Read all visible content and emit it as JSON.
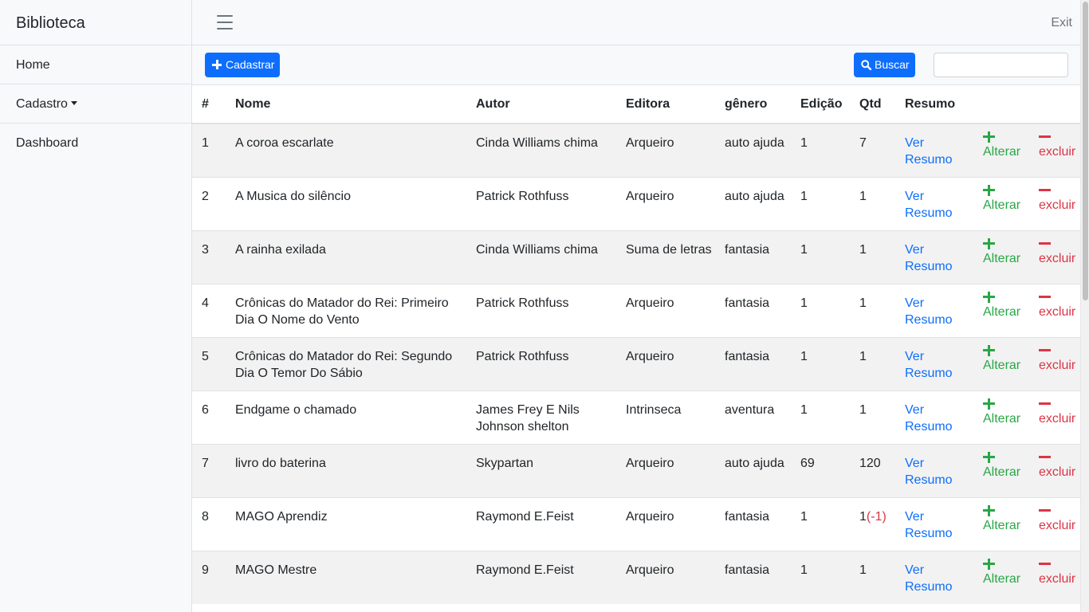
{
  "sidebar": {
    "brand": "Biblioteca",
    "items": [
      {
        "label": "Home"
      },
      {
        "label": "Cadastro"
      },
      {
        "label": "Dashboard"
      }
    ]
  },
  "topbar": {
    "exit_label": "Exit"
  },
  "toolbar": {
    "cadastrar_label": "Cadastrar",
    "buscar_label": "Buscar",
    "search_value": "",
    "search_placeholder": ""
  },
  "table": {
    "headers": [
      "#",
      "Nome",
      "Autor",
      "Editora",
      "gênero",
      "Edição",
      "Qtd",
      "Resumo"
    ],
    "ver_resumo_label": "Ver Resumo",
    "alterar_label": "Alterar",
    "excluir_label": "excluir",
    "rows": [
      {
        "id": "1",
        "nome": "A coroa escarlate",
        "autor": "Cinda Williams chima",
        "editora": "Arqueiro",
        "genero": "auto ajuda",
        "edicao": "1",
        "qtd": "7",
        "qtd_delta": ""
      },
      {
        "id": "2",
        "nome": "A Musica do silêncio",
        "autor": "Patrick Rothfuss",
        "editora": "Arqueiro",
        "genero": "auto ajuda",
        "edicao": "1",
        "qtd": "1",
        "qtd_delta": ""
      },
      {
        "id": "3",
        "nome": "A rainha exilada",
        "autor": "Cinda Williams chima",
        "editora": "Suma de letras",
        "genero": "fantasia",
        "edicao": "1",
        "qtd": "1",
        "qtd_delta": ""
      },
      {
        "id": "4",
        "nome": "Crônicas do Matador do Rei: Primeiro Dia O Nome do Vento",
        "autor": "Patrick Rothfuss",
        "editora": "Arqueiro",
        "genero": "fantasia",
        "edicao": "1",
        "qtd": "1",
        "qtd_delta": ""
      },
      {
        "id": "5",
        "nome": "Crônicas do Matador do Rei: Segundo Dia O Temor Do Sábio",
        "autor": "Patrick Rothfuss",
        "editora": "Arqueiro",
        "genero": "fantasia",
        "edicao": "1",
        "qtd": "1",
        "qtd_delta": ""
      },
      {
        "id": "6",
        "nome": "Endgame o chamado",
        "autor": "James Frey E Nils Johnson shelton",
        "editora": "Intrinseca",
        "genero": "aventura",
        "edicao": "1",
        "qtd": "1",
        "qtd_delta": ""
      },
      {
        "id": "7",
        "nome": "livro do baterina",
        "autor": "Skypartan",
        "editora": "Arqueiro",
        "genero": "auto ajuda",
        "edicao": "69",
        "qtd": "120",
        "qtd_delta": ""
      },
      {
        "id": "8",
        "nome": "MAGO Aprendiz",
        "autor": "Raymond E.Feist",
        "editora": "Arqueiro",
        "genero": "fantasia",
        "edicao": "1",
        "qtd": "1",
        "qtd_delta": "(-1)"
      },
      {
        "id": "9",
        "nome": "MAGO Mestre",
        "autor": "Raymond E.Feist",
        "editora": "Arqueiro",
        "genero": "fantasia",
        "edicao": "1",
        "qtd": "1",
        "qtd_delta": ""
      }
    ]
  },
  "colors": {
    "primary": "#0d6efd",
    "success": "#28a745",
    "danger": "#dc3545",
    "sidebar_bg": "#f8f9fa",
    "row_stripe": "#f2f2f2"
  },
  "icons": {
    "menu": "hamburger-icon",
    "add": "plus-icon",
    "search": "search-icon",
    "edit": "plus-icon",
    "delete": "minus-icon",
    "dropdown": "caret-down-icon"
  }
}
